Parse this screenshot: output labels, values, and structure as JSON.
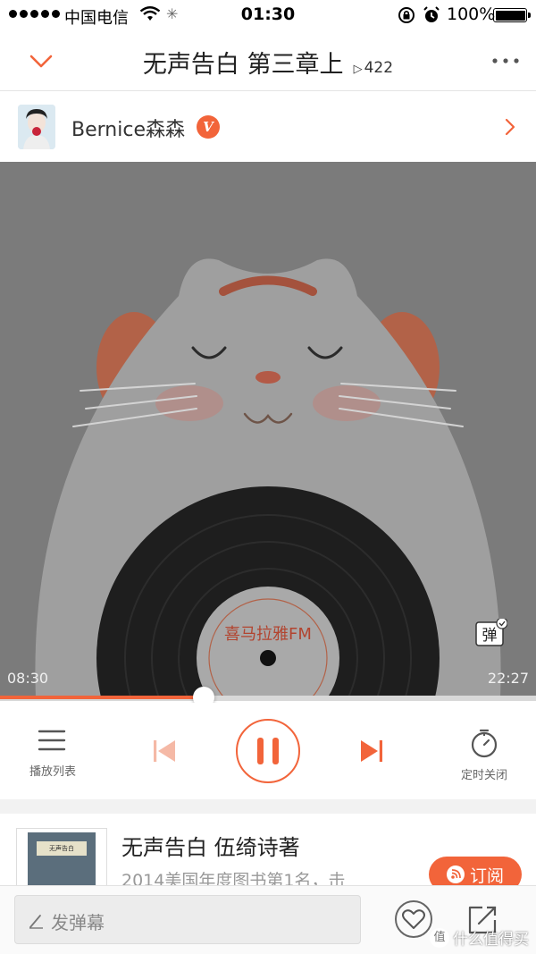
{
  "status_bar": {
    "carrier": "中国电信",
    "time": "01:30",
    "battery": "100%"
  },
  "header": {
    "title": "无声告白 第三章上",
    "play_count": "422"
  },
  "author": {
    "name": "Bernice森森",
    "badge": "V"
  },
  "player": {
    "cover_brand": "喜马拉雅FM",
    "elapsed": "08:30",
    "duration": "22:27",
    "progress": 0.38,
    "danmu_toggle": "弹"
  },
  "controls": {
    "playlist_label": "播放列表",
    "timer_label": "定时关闭"
  },
  "album": {
    "title": "无声告白 伍绮诗著",
    "description": "2014美国年度图书第1名，击",
    "subscribe_label": "订阅",
    "book_cover_text": "无声告白"
  },
  "bottom_bar": {
    "danmu_placeholder": "发弹幕"
  },
  "watermark": {
    "text": "什么值得买",
    "icon_text": "值"
  },
  "colors": {
    "accent": "#f2643a",
    "cover_bg": "#7b7b7b"
  }
}
